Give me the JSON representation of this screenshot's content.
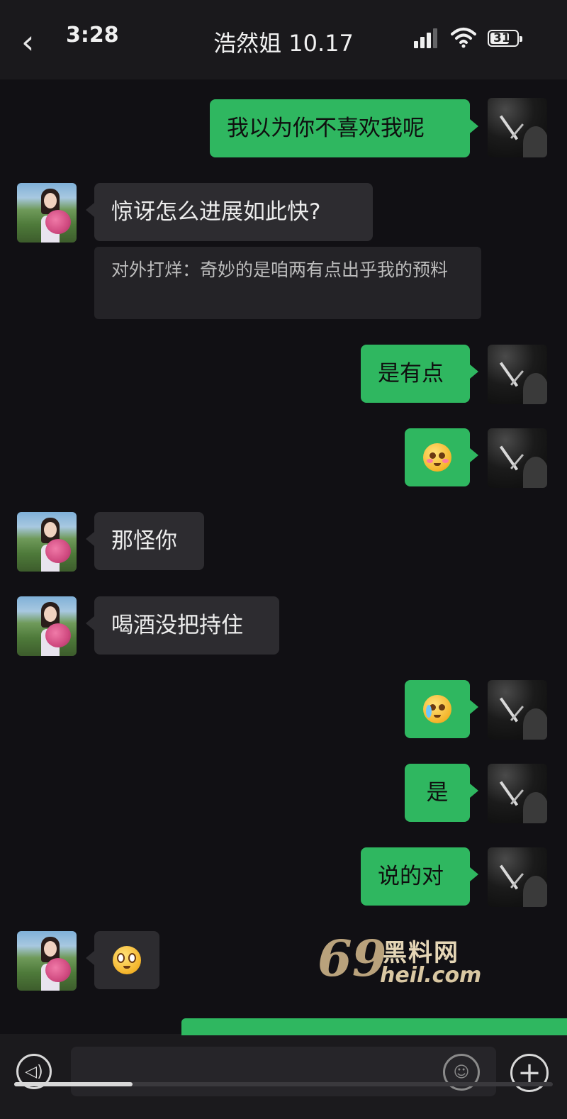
{
  "status_bar": {
    "time": "3:28",
    "battery": "31"
  },
  "header": {
    "back_icon": "chevron-left-icon",
    "title": "浩然姐 10.17"
  },
  "messages": [
    {
      "side": "out",
      "text": "我以为你不喜欢我呢"
    },
    {
      "side": "in",
      "text": "惊讶怎么进展如此快?"
    },
    {
      "side": "in",
      "quote": "对外打烊：奇妙的是咱两有点出乎我的预料"
    },
    {
      "side": "out",
      "text": "是有点"
    },
    {
      "side": "out",
      "emoji": "blushing-face-emoji"
    },
    {
      "side": "in",
      "text": "那怪你"
    },
    {
      "side": "in",
      "text": "喝酒没把持住"
    },
    {
      "side": "out",
      "emoji": "teary-face-emoji"
    },
    {
      "side": "out",
      "text": "是"
    },
    {
      "side": "out",
      "text": "说的对"
    },
    {
      "side": "in",
      "emoji": "pleading-face-emoji"
    }
  ],
  "watermark": {
    "number": "69",
    "brand": "黑料网",
    "domain": "heil.com"
  },
  "input_bar": {
    "voice_icon": "voice-icon",
    "emoji_icon": "emoji-icon",
    "plus_icon": "plus-icon",
    "progress": 0.22
  },
  "colors": {
    "outgoing_bubble": "#2fb760",
    "incoming_bubble": "#2d2c30",
    "background": "#111014"
  }
}
